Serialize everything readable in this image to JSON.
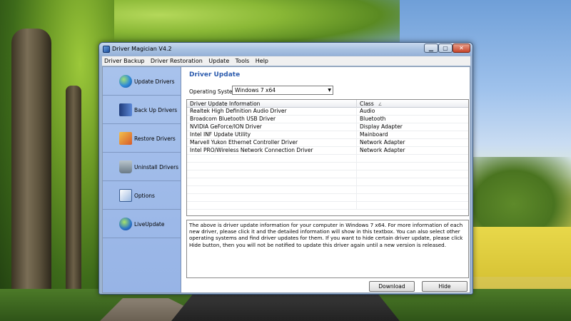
{
  "window": {
    "title": "Driver Magician V4.2",
    "controls": {
      "minimize": "▁",
      "maximize": "▢",
      "close": "✕"
    }
  },
  "menu": [
    "Driver Backup",
    "Driver Restoration",
    "Update",
    "Tools",
    "Help"
  ],
  "sidebar": {
    "items": [
      {
        "label": "Update Drivers",
        "icon": "globe-update-icon"
      },
      {
        "label": "Back Up Drivers",
        "icon": "backup-book-icon"
      },
      {
        "label": "Restore Drivers",
        "icon": "restore-icon"
      },
      {
        "label": "Uninstall Drivers",
        "icon": "recycle-bin-icon"
      },
      {
        "label": "Options",
        "icon": "options-icon"
      },
      {
        "label": "LiveUpdate",
        "icon": "globe-liveupdate-icon"
      }
    ]
  },
  "main": {
    "title": "Driver Update",
    "os_label": "Operating System:",
    "os_selected": "Windows 7 x64",
    "table": {
      "headers": [
        "Driver Update Information",
        "Class"
      ],
      "sort_indicator": "∠",
      "rows": [
        [
          "Realtek High Definition Audio Driver",
          "Audio"
        ],
        [
          "Broadcom Bluetooth USB Driver",
          "Bluetooth"
        ],
        [
          "NVIDIA GeForce/ION Driver",
          "Display Adapter"
        ],
        [
          "Intel INF Update Utility",
          "Mainboard"
        ],
        [
          "Marvell Yukon Ethernet Controller Driver",
          "Network Adapter"
        ],
        [
          "Intel PRO/Wireless Network Connection Driver",
          "Network Adapter"
        ]
      ]
    },
    "description": "The above is driver update information for your computer in Windows 7 x64. For more information of each new driver, please click it and the detailed information will show in this textbox. You can also select other operating systems and find driver updates for them. If you want to hide certain driver update, please click Hide button, then you will not be notified to update this driver again until a new version is released.",
    "buttons": {
      "download": "Download",
      "hide": "Hide"
    }
  }
}
